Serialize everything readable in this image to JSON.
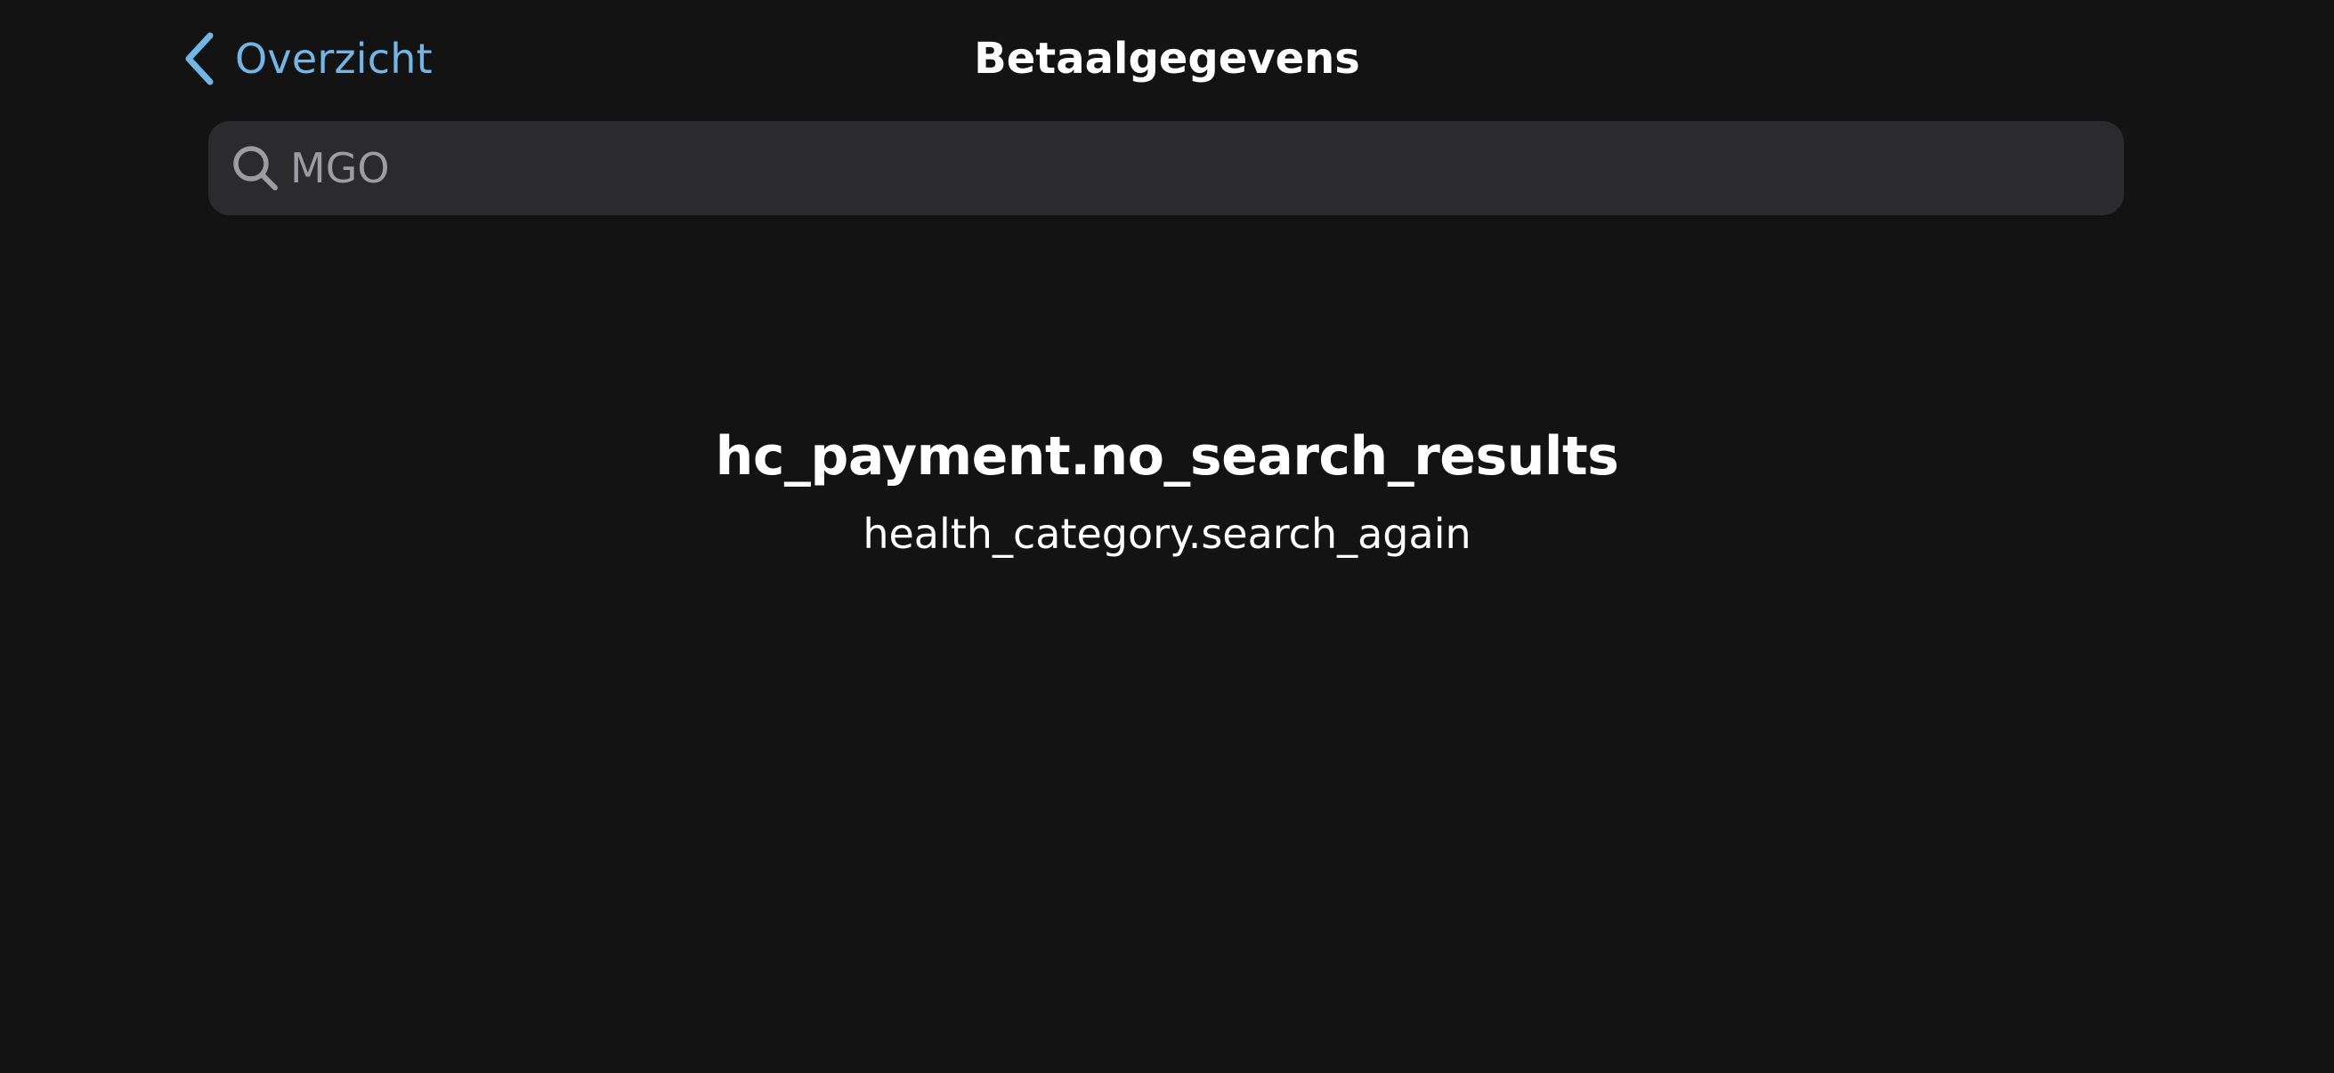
{
  "nav": {
    "back_label": "Overzicht",
    "title": "Betaalgegevens"
  },
  "search": {
    "value": "MGO",
    "icon": "search-icon"
  },
  "empty_state": {
    "title": "hc_payment.no_search_results",
    "subtitle": "health_category.search_again"
  },
  "colors": {
    "background": "#131314",
    "accent": "#73b5e5",
    "search_field": "#2b2b2d",
    "text_primary": "#ffffff",
    "text_secondary": "#9c9ca1"
  }
}
